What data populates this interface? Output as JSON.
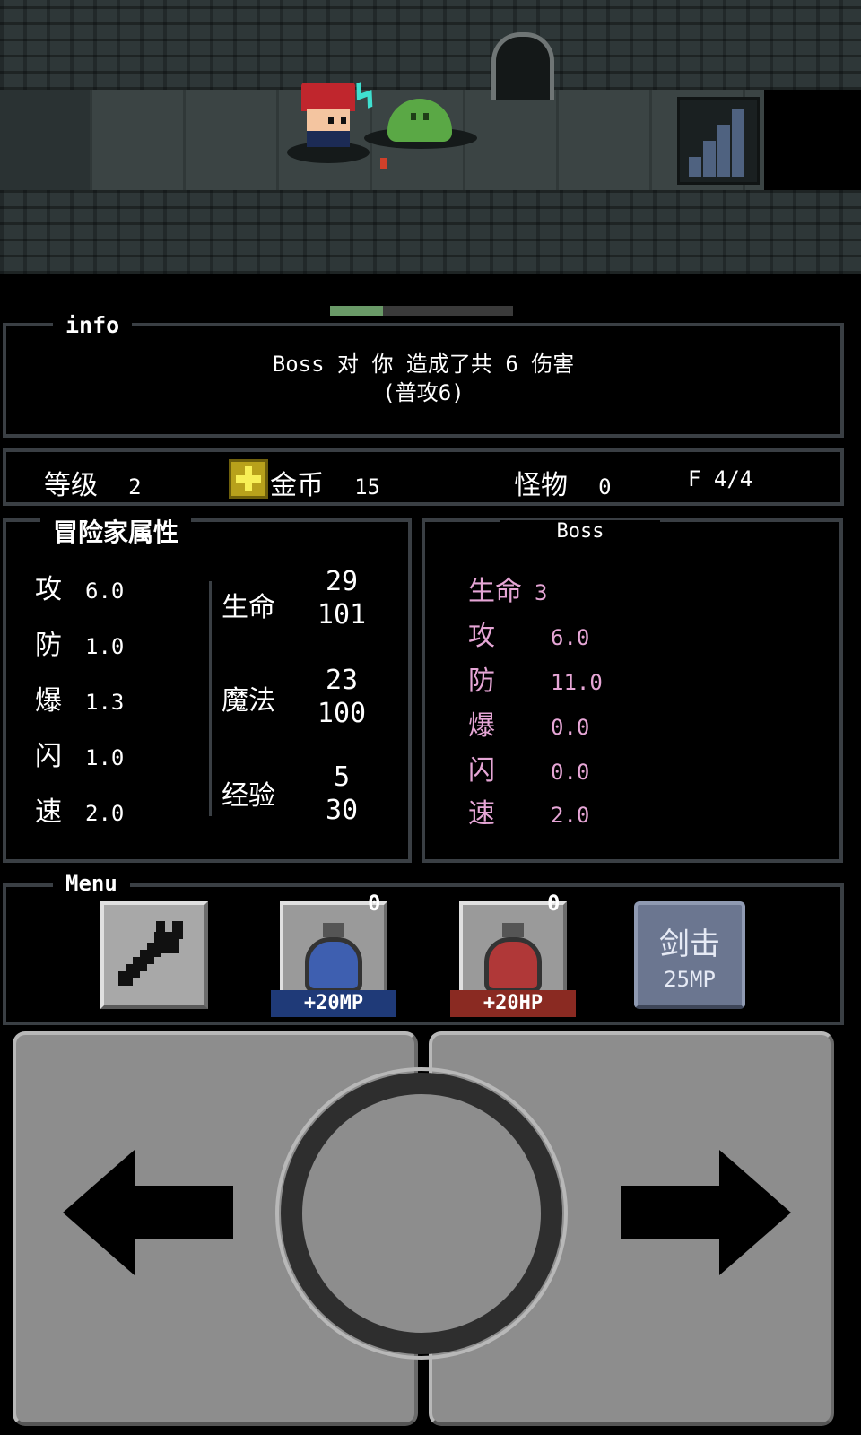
{
  "info": {
    "title": "info",
    "message_line1": "Boss 对 你 造成了共 6 伤害",
    "message_line2": "(普攻6)"
  },
  "turn_progress": 0.29,
  "status": {
    "level_label": "等级",
    "level_value": "2",
    "gold_label": "金币",
    "gold_value": "15",
    "monster_label": "怪物",
    "monster_value": "0",
    "floor_text": "F 4/4"
  },
  "hero": {
    "title": "冒险家属性",
    "attrs": [
      {
        "label": "攻",
        "value": "6.0"
      },
      {
        "label": "防",
        "value": "1.0"
      },
      {
        "label": "爆",
        "value": "1.3"
      },
      {
        "label": "闪",
        "value": "1.0"
      },
      {
        "label": "速",
        "value": "2.0"
      }
    ],
    "hp": {
      "label": "生命",
      "current": "29",
      "max": "101"
    },
    "mp": {
      "label": "魔法",
      "current": "23",
      "max": "100"
    },
    "exp": {
      "label": "经验",
      "current": "5",
      "max": "30"
    }
  },
  "boss": {
    "title": "Boss",
    "attrs": [
      {
        "label": "生命",
        "value": "3"
      },
      {
        "label": "攻",
        "value": "6.0"
      },
      {
        "label": "防",
        "value": "11.0"
      },
      {
        "label": "爆",
        "value": "0.0"
      },
      {
        "label": "闪",
        "value": "0.0"
      },
      {
        "label": "速",
        "value": "2.0"
      }
    ],
    "color": "#e6a6d6"
  },
  "menu": {
    "title": "Menu",
    "mp_potion_count": "0",
    "mp_potion_label": "+20MP",
    "hp_potion_count": "0",
    "hp_potion_label": "+20HP",
    "skill_name": "剑击",
    "skill_cost": "25MP"
  },
  "icons": {
    "settings": "wrench-icon",
    "left": "arrow-left-icon",
    "right": "arrow-right-icon",
    "action": "circle-button-icon",
    "gold": "gold-plus-icon"
  },
  "colors": {
    "panel_border": "#3a3f44",
    "mp_tag": "#1f3a78",
    "hp_tag": "#8a2a22",
    "skill_button": "#6b7690",
    "gold": "#b8a11b"
  }
}
